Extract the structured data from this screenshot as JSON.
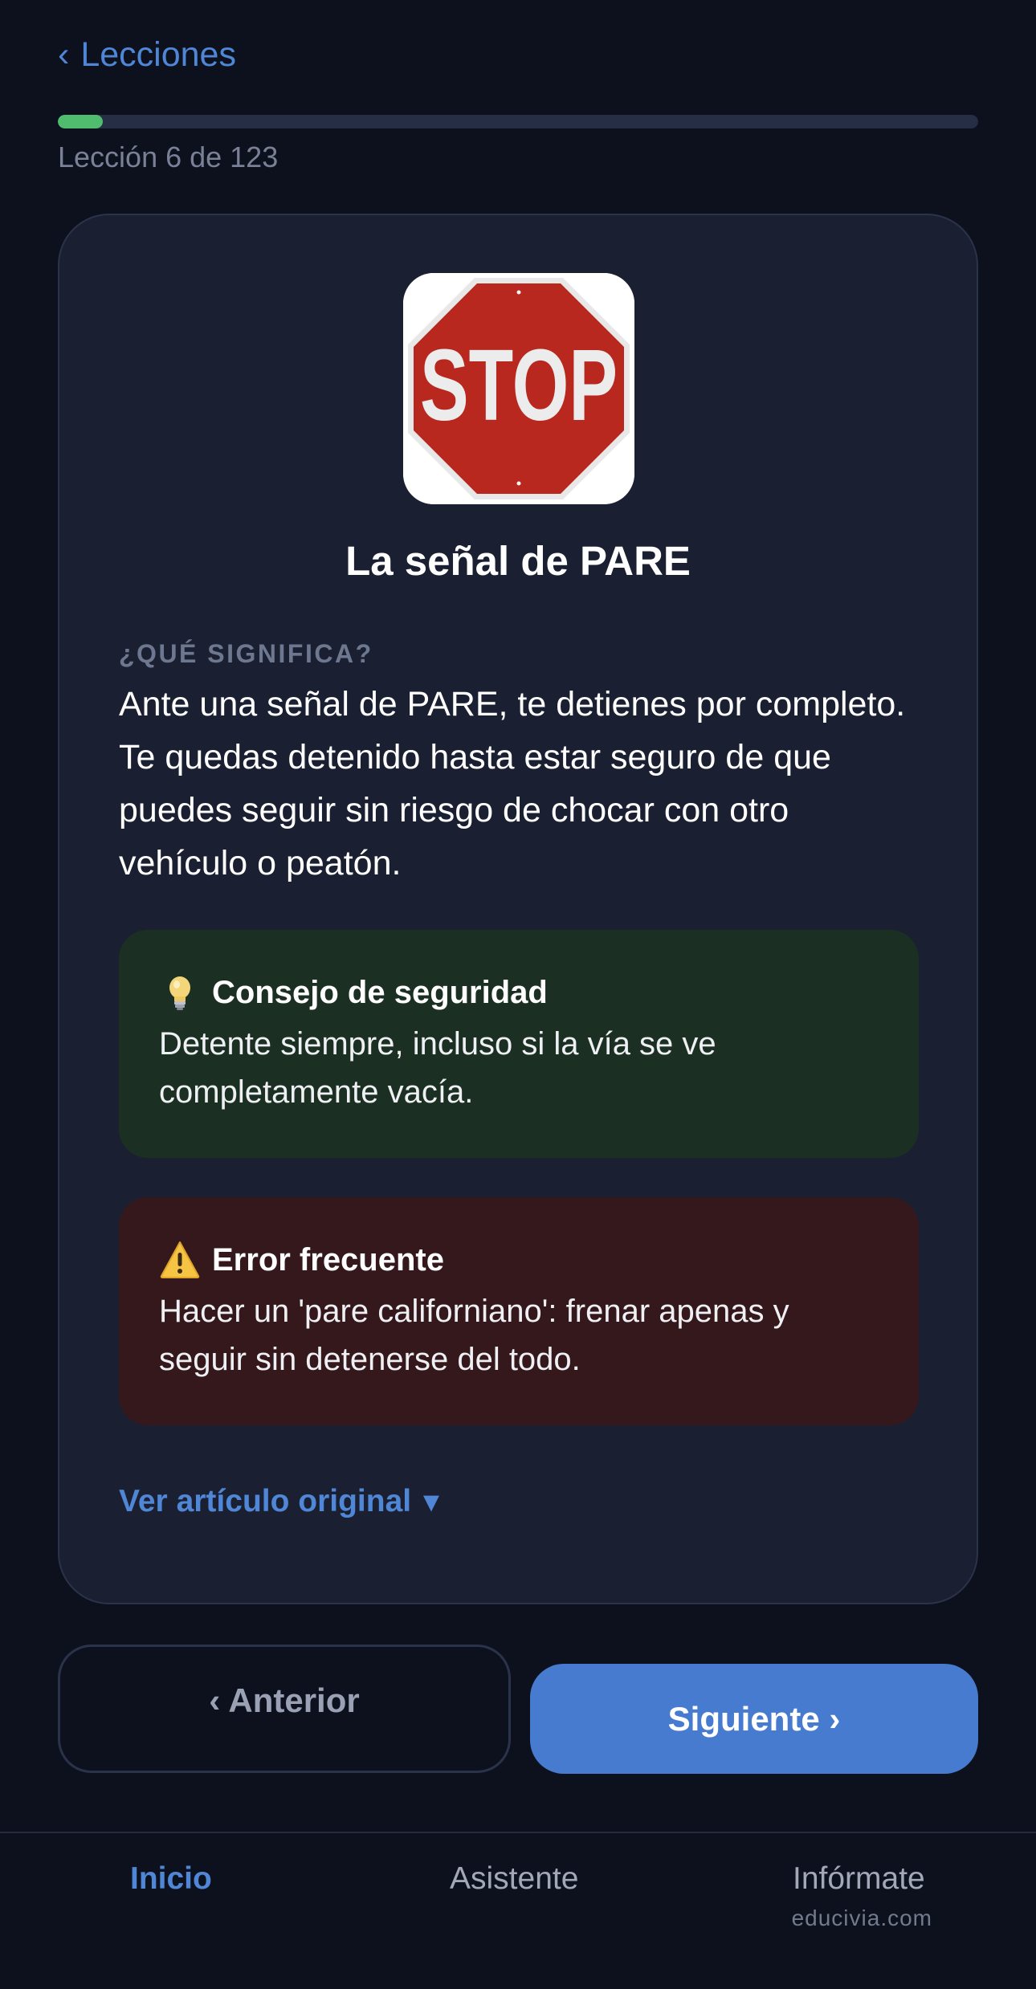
{
  "header": {
    "back_label": "Lecciones",
    "back_chevron": "‹"
  },
  "progress": {
    "current": 6,
    "total": 123,
    "fraction": 0.049,
    "text": "Lección 6 de 123",
    "fill_color": "#4fbc6e"
  },
  "lesson": {
    "sign_icon": "stop-sign-icon",
    "sign_text": "STOP",
    "title": "La señal de PARE",
    "section_label": "¿QUÉ SIGNIFICA?",
    "description": "Ante una señal de PARE, te detienes por completo. Te quedas detenido hasta estar seguro de que puedes seguir sin riesgo de chocar con otro vehículo o peatón."
  },
  "safety_tip": {
    "icon": "lightbulb-icon",
    "title": "Consejo de seguridad",
    "body": "Detente siempre, incluso si la vía se ve completamente vacía.",
    "color": "#1b3023"
  },
  "common_error": {
    "icon": "warning-icon",
    "title": "Error frecuente",
    "body": "Hacer un 'pare californiano': frenar apenas y seguir sin detenerse del todo.",
    "color": "#35181c"
  },
  "article_link": {
    "label": "Ver artículo original",
    "caret": "▼"
  },
  "nav": {
    "prev_label": "‹ Anterior",
    "next_label": "Siguiente ›",
    "accent": "#467bcf"
  },
  "tabbar": {
    "tabs": [
      {
        "label": "Inicio",
        "active": true
      },
      {
        "label": "Asistente",
        "active": false
      },
      {
        "label": "Infórmate",
        "active": false
      }
    ],
    "informate_sub": "educivia.com"
  }
}
